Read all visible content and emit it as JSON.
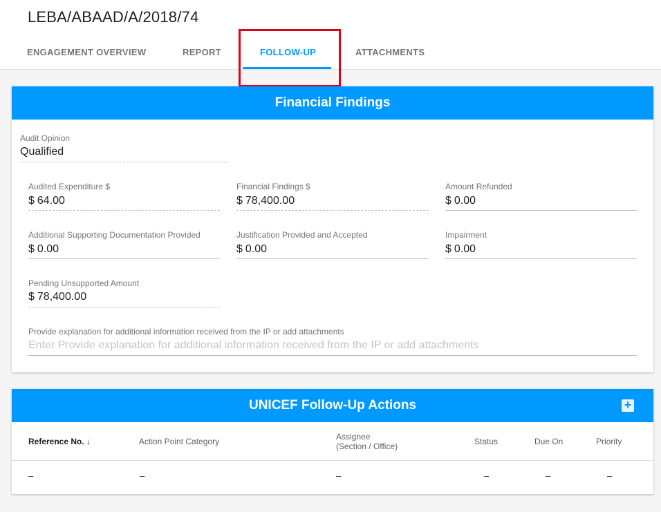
{
  "page": {
    "title": "LEBA/ABAAD/A/2018/74"
  },
  "tabs": [
    {
      "label": "ENGAGEMENT OVERVIEW",
      "active": false
    },
    {
      "label": "REPORT",
      "active": false
    },
    {
      "label": "FOLLOW-UP",
      "active": true
    },
    {
      "label": "ATTACHMENTS",
      "active": false
    }
  ],
  "financial_findings": {
    "title": "Financial Findings",
    "audit_opinion": {
      "label": "Audit Opinion",
      "value": "Qualified"
    },
    "currency_symbol": "$",
    "fields": {
      "audited_expenditure": {
        "label": "Audited Expenditure $",
        "value": "64.00"
      },
      "financial_findings": {
        "label": "Financial Findings $",
        "value": "78,400.00"
      },
      "amount_refunded": {
        "label": "Amount Refunded",
        "value": "0.00"
      },
      "additional_docs": {
        "label": "Additional Supporting Documentation Provided",
        "value": "0.00"
      },
      "justification": {
        "label": "Justification Provided and Accepted",
        "value": "0.00"
      },
      "impairment": {
        "label": "Impairment",
        "value": "0.00"
      },
      "pending_unsupported": {
        "label": "Pending Unsupported Amount",
        "value": "78,400.00"
      }
    },
    "explanation": {
      "label": "Provide explanation for additional information received from the IP or add attachments",
      "placeholder": "Enter Provide explanation for additional information received from the IP or add attachments"
    }
  },
  "follow_up_actions": {
    "title": "UNICEF Follow-Up Actions",
    "add_icon": "plus-icon",
    "columns": {
      "reference": "Reference No.",
      "sort_icon": "↓",
      "category": "Action Point Category",
      "assignee_line1": "Assignee",
      "assignee_line2": "(Section / Office)",
      "status": "Status",
      "due_on": "Due On",
      "priority": "Priority"
    },
    "rows": [
      {
        "reference": "–",
        "category": "–",
        "assignee": "–",
        "status": "–",
        "due_on": "–",
        "priority": "–"
      }
    ]
  },
  "colors": {
    "accent": "#0099ff",
    "highlight": "#e0001b"
  }
}
